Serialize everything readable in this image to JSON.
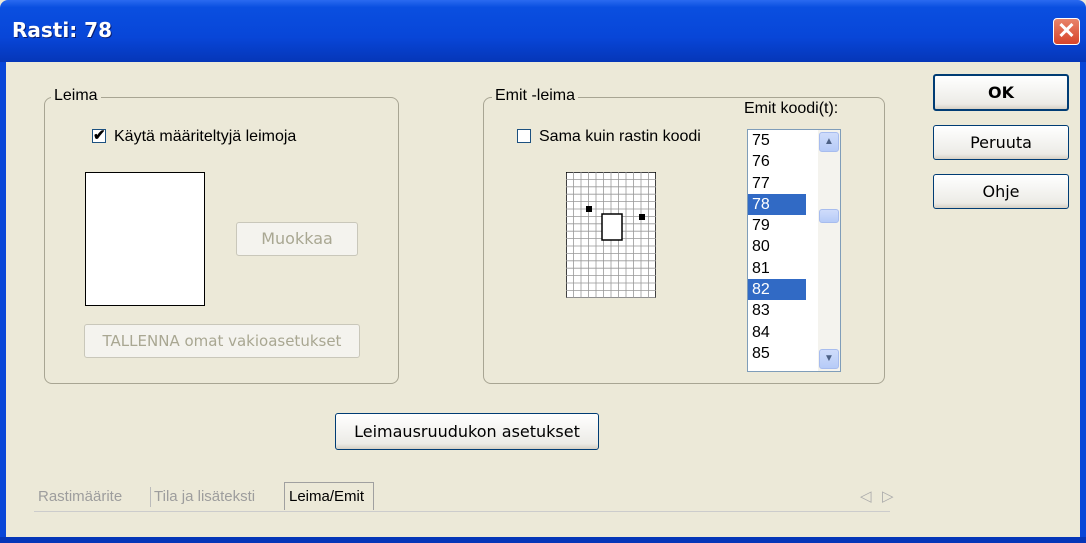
{
  "window": {
    "title": "Rasti: 78"
  },
  "leima": {
    "title": "Leima",
    "use_defined_label": "Käytä määriteltyjä leimoja",
    "use_defined_checked": true,
    "edit_button": "Muokkaa",
    "save_button": "TALLENNA omat vakioasetukset"
  },
  "emit": {
    "title": "Emit -leima",
    "same_as_code_label": "Sama kuin rastin koodi",
    "same_as_code_checked": false,
    "codes_label": "Emit koodi(t):",
    "codes": [
      "75",
      "76",
      "77",
      "78",
      "79",
      "80",
      "81",
      "82",
      "83",
      "84",
      "85"
    ],
    "selected_codes": [
      "78",
      "82"
    ]
  },
  "buttons": {
    "ok": "OK",
    "cancel": "Peruuta",
    "help": "Ohje",
    "grid_settings": "Leimausruudukon asetukset"
  },
  "tabs": [
    {
      "label": "Rastimäärite",
      "active": false
    },
    {
      "label": "Tila ja lisäteksti",
      "active": false
    },
    {
      "label": "Leima/Emit",
      "active": true
    }
  ],
  "tab_scroll": {
    "left_icon": "arrow-left-icon",
    "right_icon": "arrow-right-icon"
  }
}
